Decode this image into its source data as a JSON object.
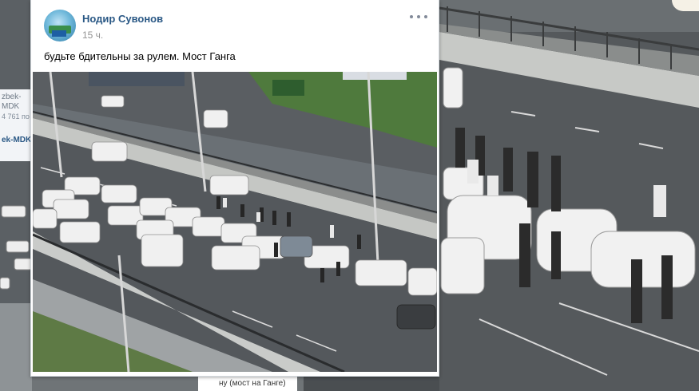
{
  "post": {
    "author": "Нодир Сувонов",
    "time": "15 ч.",
    "text": "будьте бдительны за рулем. Мост Ганга",
    "more_icon": "more-horizontal-icon",
    "photo_icon": "photo-traffic-bridge"
  },
  "background": {
    "left_badge": {
      "line1": "zbek-MDK",
      "line2": "4 761 по",
      "line3": "ek-MDK"
    },
    "bottom_chip": "ну (мост на Ганге)"
  },
  "colors": {
    "link": "#2a5885",
    "muted": "#939393",
    "card_bg": "#ffffff"
  }
}
